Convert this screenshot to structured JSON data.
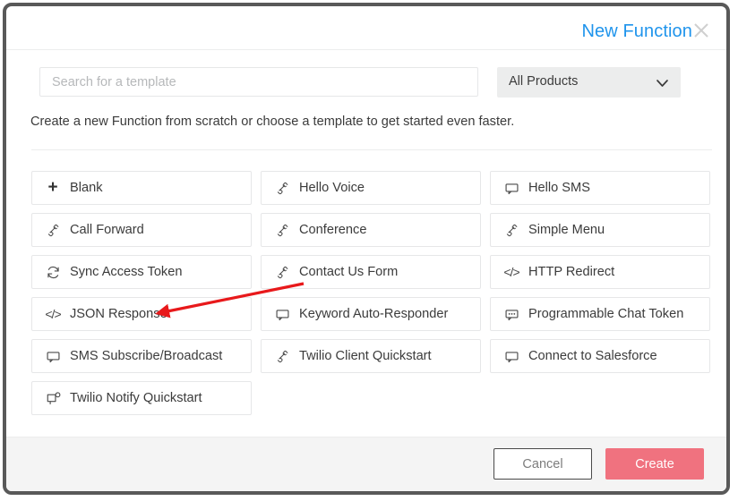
{
  "dialog": {
    "title": "New Function",
    "close_icon": "close-icon",
    "description": "Create a new Function from scratch or choose a template to get started even faster."
  },
  "search": {
    "placeholder": "Search for a template",
    "value": ""
  },
  "product_filter": {
    "selected": "All Products",
    "chevron_icon": "chevron-down-icon"
  },
  "templates": [
    {
      "label": "Blank",
      "icon": "plus-icon"
    },
    {
      "label": "Hello Voice",
      "icon": "phone-icon"
    },
    {
      "label": "Hello SMS",
      "icon": "chat-bubble-icon"
    },
    {
      "label": "Call Forward",
      "icon": "phone-icon"
    },
    {
      "label": "Conference",
      "icon": "phone-icon"
    },
    {
      "label": "Simple Menu",
      "icon": "phone-icon"
    },
    {
      "label": "Sync Access Token",
      "icon": "sync-icon"
    },
    {
      "label": "Contact Us Form",
      "icon": "phone-icon"
    },
    {
      "label": "HTTP Redirect",
      "icon": "code-icon"
    },
    {
      "label": "JSON Response",
      "icon": "code-icon"
    },
    {
      "label": "Keyword Auto-Responder",
      "icon": "chat-bubble-icon"
    },
    {
      "label": "Programmable Chat Token",
      "icon": "chat-dots-icon"
    },
    {
      "label": "SMS Subscribe/Broadcast",
      "icon": "chat-bubble-icon"
    },
    {
      "label": "Twilio Client Quickstart",
      "icon": "phone-icon"
    },
    {
      "label": "Connect to Salesforce",
      "icon": "chat-bubble-icon"
    },
    {
      "label": "Twilio Notify Quickstart",
      "icon": "chat-notify-icon"
    }
  ],
  "footer": {
    "cancel_label": "Cancel",
    "create_label": "Create"
  },
  "colors": {
    "title_blue": "#1f94ec",
    "create_pink": "#f0727f",
    "annotation_red": "#e8191b",
    "footer_bg": "#f4f4f4",
    "border_gray": "#e6e7e8",
    "frame_gray": "#595959"
  },
  "annotation": {
    "type": "arrow",
    "points_to": "JSON Response"
  }
}
